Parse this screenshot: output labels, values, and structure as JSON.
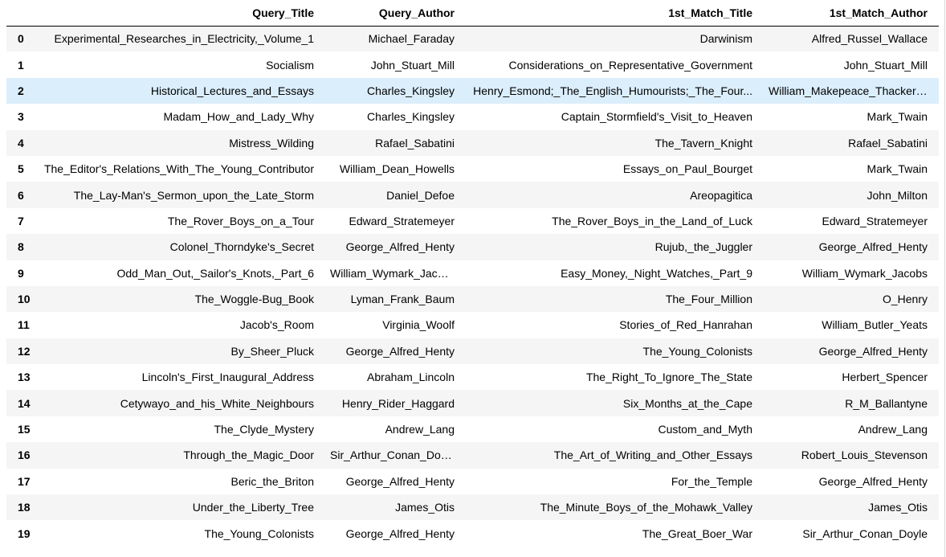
{
  "table": {
    "index_header": "",
    "columns": [
      "Query_Title",
      "Query_Author",
      "1st_Match_Title",
      "1st_Match_Author"
    ],
    "highlighted_row": 2,
    "rows": [
      {
        "index": "0",
        "cells": [
          "Experimental_Researches_in_Electricity,_Volume_1",
          "Michael_Faraday",
          "Darwinism",
          "Alfred_Russel_Wallace"
        ]
      },
      {
        "index": "1",
        "cells": [
          "Socialism",
          "John_Stuart_Mill",
          "Considerations_on_Representative_Government",
          "John_Stuart_Mill"
        ]
      },
      {
        "index": "2",
        "cells": [
          "Historical_Lectures_and_Essays",
          "Charles_Kingsley",
          "Henry_Esmond;_The_English_Humourists;_The_Four...",
          "William_Makepeace_Thackeray"
        ]
      },
      {
        "index": "3",
        "cells": [
          "Madam_How_and_Lady_Why",
          "Charles_Kingsley",
          "Captain_Stormfield's_Visit_to_Heaven",
          "Mark_Twain"
        ]
      },
      {
        "index": "4",
        "cells": [
          "Mistress_Wilding",
          "Rafael_Sabatini",
          "The_Tavern_Knight",
          "Rafael_Sabatini"
        ]
      },
      {
        "index": "5",
        "cells": [
          "The_Editor's_Relations_With_The_Young_Contributor",
          "William_Dean_Howells",
          "Essays_on_Paul_Bourget",
          "Mark_Twain"
        ]
      },
      {
        "index": "6",
        "cells": [
          "The_Lay-Man's_Sermon_upon_the_Late_Storm",
          "Daniel_Defoe",
          "Areopagitica",
          "John_Milton"
        ]
      },
      {
        "index": "7",
        "cells": [
          "The_Rover_Boys_on_a_Tour",
          "Edward_Stratemeyer",
          "The_Rover_Boys_in_the_Land_of_Luck",
          "Edward_Stratemeyer"
        ]
      },
      {
        "index": "8",
        "cells": [
          "Colonel_Thorndyke's_Secret",
          "George_Alfred_Henty",
          "Rujub,_the_Juggler",
          "George_Alfred_Henty"
        ]
      },
      {
        "index": "9",
        "cells": [
          "Odd_Man_Out,_Sailor's_Knots,_Part_6",
          "William_Wymark_Jacobs",
          "Easy_Money,_Night_Watches,_Part_9",
          "William_Wymark_Jacobs"
        ]
      },
      {
        "index": "10",
        "cells": [
          "The_Woggle-Bug_Book",
          "Lyman_Frank_Baum",
          "The_Four_Million",
          "O_Henry"
        ]
      },
      {
        "index": "11",
        "cells": [
          "Jacob's_Room",
          "Virginia_Woolf",
          "Stories_of_Red_Hanrahan",
          "William_Butler_Yeats"
        ]
      },
      {
        "index": "12",
        "cells": [
          "By_Sheer_Pluck",
          "George_Alfred_Henty",
          "The_Young_Colonists",
          "George_Alfred_Henty"
        ]
      },
      {
        "index": "13",
        "cells": [
          "Lincoln's_First_Inaugural_Address",
          "Abraham_Lincoln",
          "The_Right_To_Ignore_The_State",
          "Herbert_Spencer"
        ]
      },
      {
        "index": "14",
        "cells": [
          "Cetywayo_and_his_White_Neighbours",
          "Henry_Rider_Haggard",
          "Six_Months_at_the_Cape",
          "R_M_Ballantyne"
        ]
      },
      {
        "index": "15",
        "cells": [
          "The_Clyde_Mystery",
          "Andrew_Lang",
          "Custom_and_Myth",
          "Andrew_Lang"
        ]
      },
      {
        "index": "16",
        "cells": [
          "Through_the_Magic_Door",
          "Sir_Arthur_Conan_Doyle",
          "The_Art_of_Writing_and_Other_Essays",
          "Robert_Louis_Stevenson"
        ]
      },
      {
        "index": "17",
        "cells": [
          "Beric_the_Briton",
          "George_Alfred_Henty",
          "For_the_Temple",
          "George_Alfred_Henty"
        ]
      },
      {
        "index": "18",
        "cells": [
          "Under_the_Liberty_Tree",
          "James_Otis",
          "The_Minute_Boys_of_the_Mohawk_Valley",
          "James_Otis"
        ]
      },
      {
        "index": "19",
        "cells": [
          "The_Young_Colonists",
          "George_Alfred_Henty",
          "The_Great_Boer_War",
          "Sir_Arthur_Conan_Doyle"
        ]
      }
    ]
  },
  "colors": {
    "stripe": "#f5f5f5",
    "hover": "#dbeefb",
    "header_rule": "#000000"
  }
}
